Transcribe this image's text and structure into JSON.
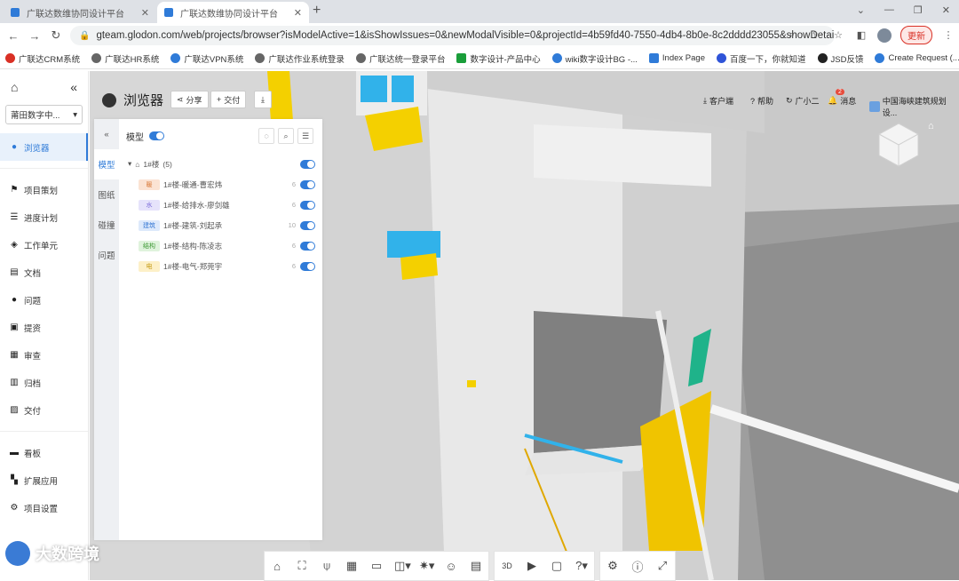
{
  "browser": {
    "tabs": [
      {
        "title": "广联达数维协同设计平台",
        "active": false
      },
      {
        "title": "广联达数维协同设计平台",
        "active": true
      }
    ],
    "url": "gteam.glodon.com/web/projects/browser?isModelActive=1&isShowIssues=0&newModalVisible=0&projectId=4b59fd40-7550-4db4-8b0e-8c2dddd23055&showDetail=0",
    "update_label": "更新",
    "bookmarks": [
      "广联达CRM系统",
      "广联达HR系统",
      "广联达VPN系统",
      "广联达作业系统登录",
      "广联达统一登录平台",
      "数字设计-产品中心",
      "wiki数字设计BG -...",
      "Index Page",
      "百度一下，你就知道",
      "JSD反馈",
      "Create Request (..."
    ]
  },
  "sidebar": {
    "project": "莆田数字中...",
    "items": [
      {
        "label": "浏览器",
        "icon": "globe-icon",
        "active": true
      },
      {
        "label": "项目策划",
        "icon": "flag-icon"
      },
      {
        "label": "进度计划",
        "icon": "schedule-icon"
      },
      {
        "label": "工作单元",
        "icon": "cube-icon"
      },
      {
        "label": "文档",
        "icon": "document-icon"
      },
      {
        "label": "问题",
        "icon": "question-icon"
      },
      {
        "label": "提资",
        "icon": "upload-icon"
      },
      {
        "label": "审查",
        "icon": "review-icon"
      },
      {
        "label": "归档",
        "icon": "archive-icon"
      },
      {
        "label": "交付",
        "icon": "delivery-icon"
      },
      {
        "label": "看板",
        "icon": "dashboard-icon"
      },
      {
        "label": "扩展应用",
        "icon": "grid-icon"
      },
      {
        "label": "项目设置",
        "icon": "gear-icon"
      }
    ]
  },
  "toolbar": {
    "title": "浏览器",
    "share": "分享",
    "deliver": "交付",
    "service": "客户端",
    "help": "帮助",
    "assistant": "广小二",
    "messages": "消息",
    "message_count": "2",
    "org": "中国海峡建筑规划设..."
  },
  "panel": {
    "tabs": [
      "模型",
      "图纸",
      "碰撞",
      "问题"
    ],
    "model_label": "模型",
    "root": {
      "name": "1#楼",
      "count": "(5)"
    },
    "rows": [
      {
        "tag": "暖",
        "tag_color": "#fbe3d3",
        "name": "1#楼-暖通-曹宏炜",
        "count": "6"
      },
      {
        "tag": "水",
        "tag_color": "#e6e3fb",
        "name": "1#楼-给排水-廖剑雄",
        "count": "6"
      },
      {
        "tag": "建筑",
        "tag_color": "#dde9fb",
        "name": "1#楼-建筑-刘起承",
        "count": "10"
      },
      {
        "tag": "结构",
        "tag_color": "#dff3dc",
        "name": "1#楼-结构-陈凌志",
        "count": "6"
      },
      {
        "tag": "电",
        "tag_color": "#fdf0c8",
        "name": "1#楼-电气-郑莞宇",
        "count": "6"
      }
    ]
  },
  "watermark": "大数跨境",
  "colors": {
    "accent": "#2f7bd8"
  }
}
